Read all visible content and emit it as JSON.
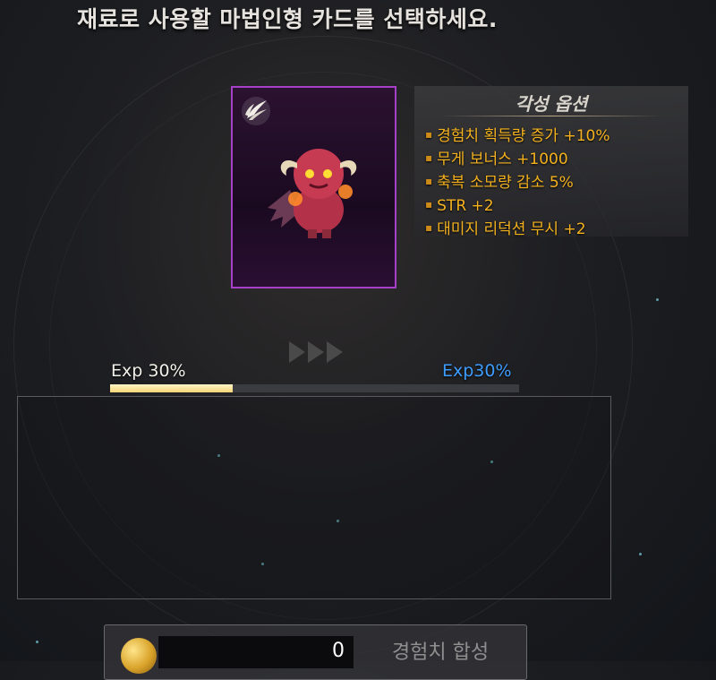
{
  "instruction": "재료로 사용할 마법인형 카드를 선택하세요.",
  "card": {
    "wing_icon": "wing-icon",
    "image": "red-devil-doll",
    "frame_color": "#a640c9"
  },
  "awakening": {
    "title": "각성 옵션",
    "options": [
      "경험치 획득량 증가 +10%",
      "무게 보너스 +1000",
      "축복 소모량 감소 5%",
      "STR +2",
      "대미지 리덕션 무시 +2"
    ],
    "color": "#f5b21e"
  },
  "exp": {
    "current_label": "Exp 30%",
    "result_label": "Exp30%",
    "progress": 0.3
  },
  "bottom": {
    "cost": "0",
    "synthesize_label": "경험치 합성"
  }
}
